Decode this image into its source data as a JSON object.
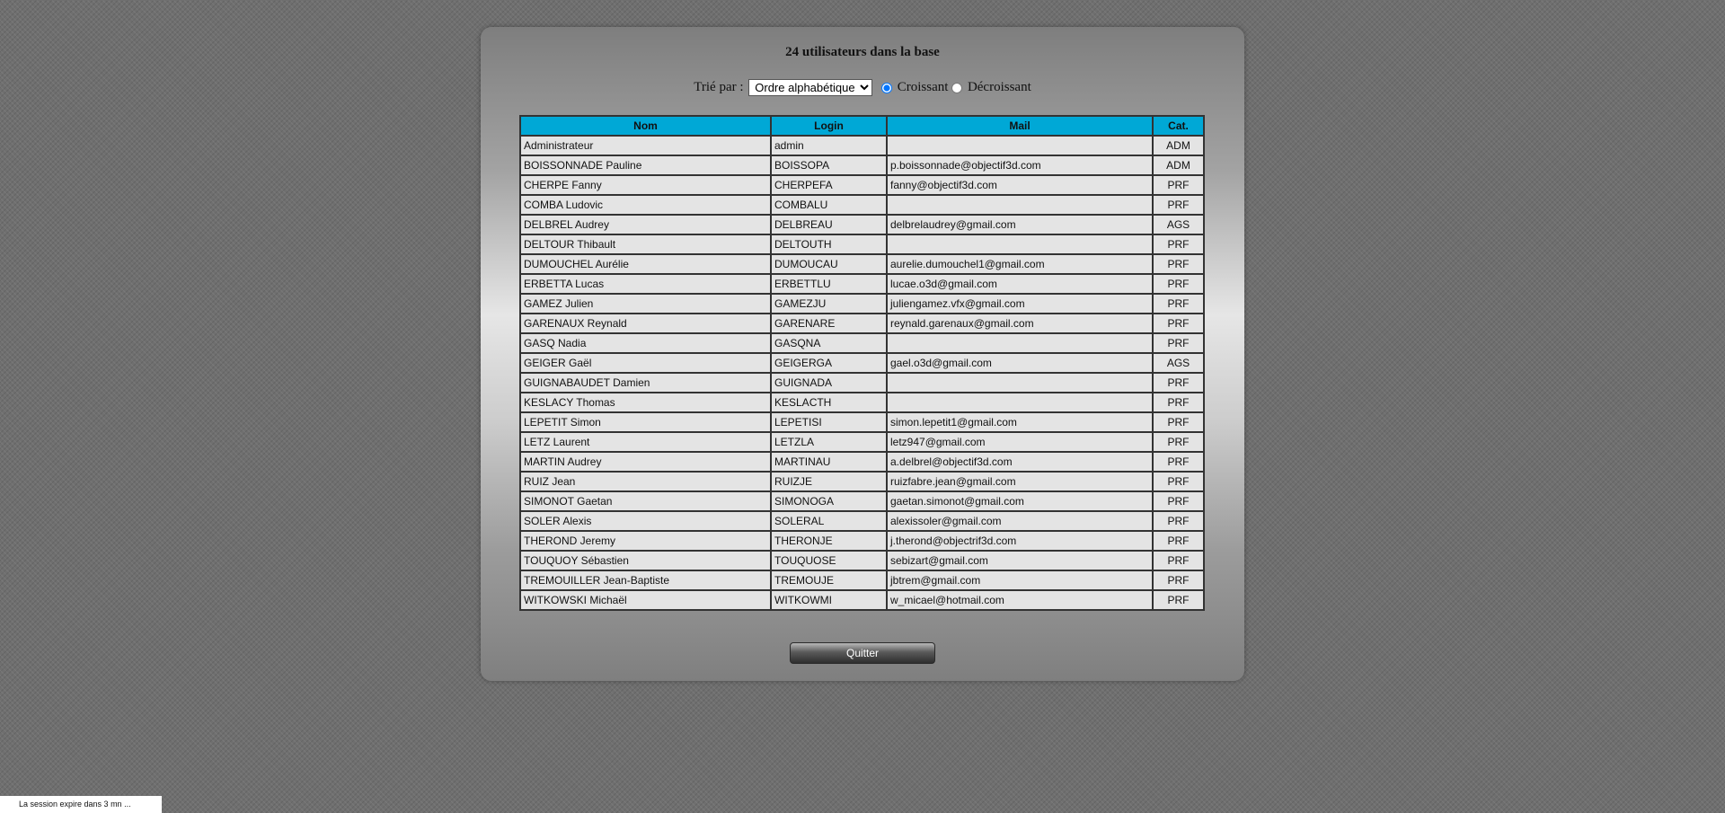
{
  "title": "24 utilisateurs dans la base",
  "sort": {
    "label": "Trié par :",
    "selected": "Ordre alphabétique",
    "asc_label": "Croissant",
    "desc_label": "Décroissant",
    "order": "asc"
  },
  "table": {
    "headers": [
      "Nom",
      "Login",
      "Mail",
      "Cat."
    ],
    "rows": [
      [
        "Administrateur",
        "admin",
        "",
        "ADM"
      ],
      [
        "BOISSONNADE Pauline",
        "BOISSOPA",
        "p.boissonnade@objectif3d.com",
        "ADM"
      ],
      [
        "CHERPE Fanny",
        "CHERPEFA",
        "fanny@objectif3d.com",
        "PRF"
      ],
      [
        "COMBA Ludovic",
        "COMBALU",
        "",
        "PRF"
      ],
      [
        "DELBREL Audrey",
        "DELBREAU",
        "delbrelaudrey@gmail.com",
        "AGS"
      ],
      [
        "DELTOUR Thibault",
        "DELTOUTH",
        "",
        "PRF"
      ],
      [
        "DUMOUCHEL Aurélie",
        "DUMOUCAU",
        "aurelie.dumouchel1@gmail.com",
        "PRF"
      ],
      [
        "ERBETTA Lucas",
        "ERBETTLU",
        "lucae.o3d@gmail.com",
        "PRF"
      ],
      [
        "GAMEZ Julien",
        "GAMEZJU",
        "juliengamez.vfx@gmail.com",
        "PRF"
      ],
      [
        "GARENAUX Reynald",
        "GARENARE",
        "reynald.garenaux@gmail.com",
        "PRF"
      ],
      [
        "GASQ Nadia",
        "GASQNA",
        "",
        "PRF"
      ],
      [
        "GEIGER Gaël",
        "GEIGERGA",
        "gael.o3d@gmail.com",
        "AGS"
      ],
      [
        "GUIGNABAUDET Damien",
        "GUIGNADA",
        "",
        "PRF"
      ],
      [
        "KESLACY Thomas",
        "KESLACTH",
        "",
        "PRF"
      ],
      [
        "LEPETIT Simon",
        "LEPETISI",
        "simon.lepetit1@gmail.com",
        "PRF"
      ],
      [
        "LETZ Laurent",
        "LETZLA",
        "letz947@gmail.com",
        "PRF"
      ],
      [
        "MARTIN Audrey",
        "MARTINAU",
        "a.delbrel@objectif3d.com",
        "PRF"
      ],
      [
        "RUIZ Jean",
        "RUIZJE",
        "ruizfabre.jean@gmail.com",
        "PRF"
      ],
      [
        "SIMONOT Gaetan",
        "SIMONOGA",
        "gaetan.simonot@gmail.com",
        "PRF"
      ],
      [
        "SOLER Alexis",
        "SOLERAL",
        "alexissoler@gmail.com",
        "PRF"
      ],
      [
        "THEROND Jeremy",
        "THERONJE",
        "j.therond@objectrif3d.com",
        "PRF"
      ],
      [
        "TOUQUOY Sébastien",
        "TOUQUOSE",
        "sebizart@gmail.com",
        "PRF"
      ],
      [
        "TREMOUILLER Jean-Baptiste",
        "TREMOUJE",
        "jbtrem@gmail.com",
        "PRF"
      ],
      [
        "WITKOWSKI Michaël",
        "WITKOWMI",
        "w_micael@hotmail.com",
        "PRF"
      ]
    ]
  },
  "quit_label": "Quitter",
  "session_text": "La session expire dans 3 mn ...",
  "colors": {
    "header_bg": "#00a8d6",
    "cell_bg": "#e4e4e4"
  }
}
